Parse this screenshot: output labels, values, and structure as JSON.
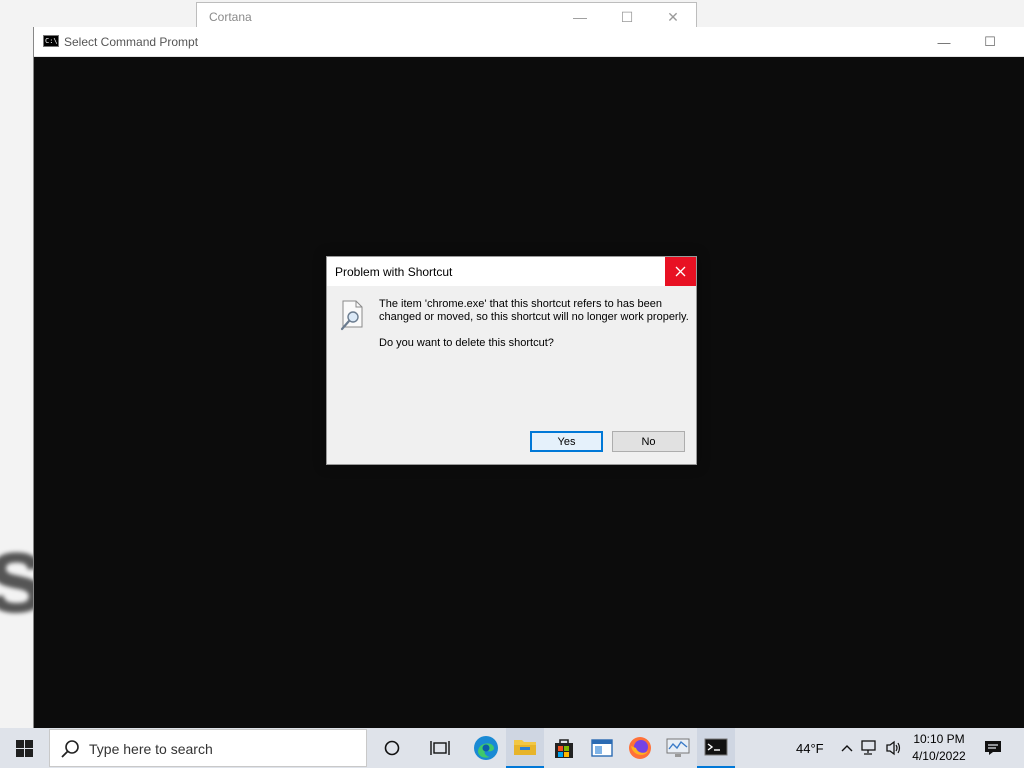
{
  "background_window": {
    "title": "Cortana",
    "controls": {
      "minimize": "—",
      "maximize": "☐",
      "close": "✕"
    }
  },
  "cmd_window": {
    "title": "Select Command Prompt",
    "controls": {
      "minimize": "—",
      "maximize": "☐"
    }
  },
  "dialog": {
    "title": "Problem with Shortcut",
    "message_line1": "The item 'chrome.exe' that this shortcut refers to has been",
    "message_line2": "changed or moved, so this shortcut will no longer work properly.",
    "question": "Do you want to delete this shortcut?",
    "yes_label": "Yes",
    "no_label": "No",
    "close_color": "#e81123"
  },
  "taskbar": {
    "search_placeholder": "Type here to search",
    "apps": [
      {
        "name": "cortana",
        "icon": "circle-icon"
      },
      {
        "name": "task-view",
        "icon": "task-view-icon"
      },
      {
        "name": "edge",
        "icon": "edge-icon"
      },
      {
        "name": "file-explorer",
        "icon": "folder-icon",
        "active": true
      },
      {
        "name": "store",
        "icon": "store-icon"
      },
      {
        "name": "remote-desktop",
        "icon": "window-icon"
      },
      {
        "name": "firefox",
        "icon": "firefox-icon"
      },
      {
        "name": "performance-monitor",
        "icon": "monitor-chart-icon"
      },
      {
        "name": "command-prompt",
        "icon": "cmd-icon",
        "active": true
      }
    ],
    "weather": "44°F",
    "time": "10:10 PM",
    "date": "4/10/2022",
    "accent": "#0078d7"
  }
}
